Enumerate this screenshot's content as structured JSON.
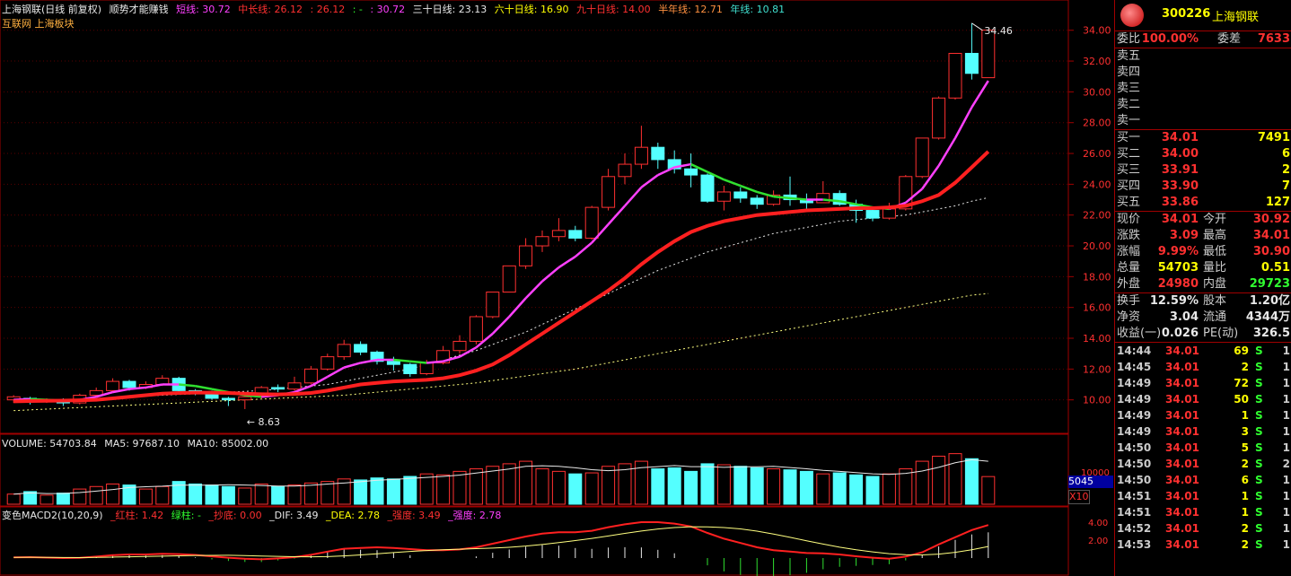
{
  "header": {
    "stock": "上海钢联(日线 前复权)",
    "title": "顺势才能赚钱",
    "ma_short": "短线: 30.72",
    "ma_mid": "中长线: 26.12",
    "ma_mid2": ": 26.12",
    "ma_dash": ": -",
    "ma_x": ": 30.72",
    "ma30": "三十日线: 23.13",
    "ma60": "六十日线: 16.90",
    "ma90": "九十日线: 14.00",
    "ma120": "半年线: 12.71",
    "ma250": "年线: 10.81",
    "sector": "互联网 上海板块"
  },
  "price_axis": [
    "34.00",
    "32.00",
    "30.00",
    "28.00",
    "26.00",
    "24.00",
    "22.00",
    "20.00",
    "18.00",
    "16.00",
    "14.00",
    "12.00",
    "10.00"
  ],
  "annotations": {
    "high": "34.46",
    "low": "8.63"
  },
  "volume": {
    "header_vol": "VOLUME: 54703.84",
    "header_ma5": "MA5: 97687.10",
    "header_ma10": "MA10: 85002.00",
    "axis_top": "10000",
    "box_value": "5045",
    "box_unit": "X10"
  },
  "macd": {
    "name": "变色MACD2(10,20,9)",
    "red_bar": "_红柱: 1.42",
    "green_bar": "绿柱: -",
    "bottom": "_抄底: 0.00",
    "dif": "_DIF: 3.49",
    "dea": "_DEA: 2.78",
    "strong1": "_强度: 3.49",
    "strong2": "_强度: 2.78",
    "axis": [
      "4.00",
      "2.00"
    ]
  },
  "quote": {
    "code": "300226",
    "name": "上海钢联",
    "weibi_label": "委比",
    "weibi": "100.00%",
    "weicha_label": "委差",
    "weicha": "7633",
    "sell": [
      {
        "label": "卖五",
        "price": "",
        "vol": ""
      },
      {
        "label": "卖四",
        "price": "",
        "vol": ""
      },
      {
        "label": "卖三",
        "price": "",
        "vol": ""
      },
      {
        "label": "卖二",
        "price": "",
        "vol": ""
      },
      {
        "label": "卖一",
        "price": "",
        "vol": ""
      }
    ],
    "buy": [
      {
        "label": "买一",
        "price": "34.01",
        "vol": "7491"
      },
      {
        "label": "买二",
        "price": "34.00",
        "vol": "6"
      },
      {
        "label": "买三",
        "price": "33.91",
        "vol": "2"
      },
      {
        "label": "买四",
        "price": "33.90",
        "vol": "7"
      },
      {
        "label": "买五",
        "price": "33.86",
        "vol": "127"
      }
    ],
    "stats": [
      {
        "l1": "现价",
        "v1": "34.01",
        "c1": "red",
        "l2": "今开",
        "v2": "30.92",
        "c2": "red"
      },
      {
        "l1": "涨跌",
        "v1": "3.09",
        "c1": "red",
        "l2": "最高",
        "v2": "34.01",
        "c2": "red"
      },
      {
        "l1": "涨幅",
        "v1": "9.99%",
        "c1": "red",
        "l2": "最低",
        "v2": "30.90",
        "c2": "red"
      },
      {
        "l1": "总量",
        "v1": "54703",
        "c1": "yel",
        "l2": "量比",
        "v2": "0.51",
        "c2": "yel"
      },
      {
        "l1": "外盘",
        "v1": "24980",
        "c1": "red",
        "l2": "内盘",
        "v2": "29723",
        "c2": "grn"
      }
    ],
    "stats2": [
      {
        "l1": "换手",
        "v1": "12.59%",
        "l2": "股本",
        "v2": "1.20亿"
      },
      {
        "l1": "净资",
        "v1": "3.04",
        "l2": "流通",
        "v2": "4344万"
      },
      {
        "l1": "收益(一)",
        "v1": "0.026",
        "l2": "PE(动)",
        "v2": "326.5"
      }
    ],
    "ticks": [
      {
        "t": "14:44",
        "p": "34.01",
        "v": "69",
        "bs": "S",
        "n": "1"
      },
      {
        "t": "14:45",
        "p": "34.01",
        "v": "2",
        "bs": "S",
        "n": "1"
      },
      {
        "t": "14:49",
        "p": "34.01",
        "v": "72",
        "bs": "S",
        "n": "1"
      },
      {
        "t": "14:49",
        "p": "34.01",
        "v": "50",
        "bs": "S",
        "n": "1"
      },
      {
        "t": "14:49",
        "p": "34.01",
        "v": "1",
        "bs": "S",
        "n": "1"
      },
      {
        "t": "14:49",
        "p": "34.01",
        "v": "3",
        "bs": "S",
        "n": "1"
      },
      {
        "t": "14:50",
        "p": "34.01",
        "v": "5",
        "bs": "S",
        "n": "1"
      },
      {
        "t": "14:50",
        "p": "34.01",
        "v": "2",
        "bs": "S",
        "n": "2"
      },
      {
        "t": "14:50",
        "p": "34.01",
        "v": "6",
        "bs": "S",
        "n": "1"
      },
      {
        "t": "14:51",
        "p": "34.01",
        "v": "1",
        "bs": "S",
        "n": "1"
      },
      {
        "t": "14:51",
        "p": "34.01",
        "v": "1",
        "bs": "S",
        "n": "1"
      },
      {
        "t": "14:52",
        "p": "34.01",
        "v": "2",
        "bs": "S",
        "n": "1"
      },
      {
        "t": "14:53",
        "p": "34.01",
        "v": "2",
        "bs": "S",
        "n": "1"
      }
    ]
  },
  "chart_data": {
    "type": "candlestick",
    "ylim": [
      8.0,
      34.8
    ],
    "candles": [
      [
        10.0,
        10.2,
        9.8,
        10.3
      ],
      [
        10.1,
        9.9,
        9.7,
        10.2
      ],
      [
        9.9,
        10.0,
        9.8,
        10.1
      ],
      [
        10.0,
        9.8,
        9.6,
        10.1
      ],
      [
        9.8,
        10.3,
        9.7,
        10.4
      ],
      [
        10.3,
        10.6,
        10.2,
        10.8
      ],
      [
        10.6,
        11.2,
        10.5,
        11.4
      ],
      [
        11.2,
        10.8,
        10.6,
        11.3
      ],
      [
        10.8,
        11.0,
        10.7,
        11.2
      ],
      [
        11.0,
        11.4,
        10.9,
        11.6
      ],
      [
        11.4,
        10.6,
        10.5,
        11.5
      ],
      [
        10.6,
        10.5,
        10.3,
        10.7
      ],
      [
        10.5,
        10.1,
        10.0,
        10.6
      ],
      [
        10.1,
        10.0,
        9.6,
        10.2
      ],
      [
        10.0,
        10.2,
        9.4,
        10.3
      ],
      [
        10.2,
        10.8,
        10.1,
        10.9
      ],
      [
        10.8,
        10.7,
        10.5,
        11.0
      ],
      [
        10.7,
        11.1,
        10.6,
        11.5
      ],
      [
        11.1,
        12.0,
        11.0,
        12.2
      ],
      [
        12.0,
        12.8,
        11.9,
        13.0
      ],
      [
        12.8,
        13.6,
        12.6,
        13.9
      ],
      [
        13.6,
        13.1,
        12.9,
        13.8
      ],
      [
        13.1,
        12.5,
        12.3,
        13.2
      ],
      [
        12.5,
        12.3,
        11.9,
        12.8
      ],
      [
        12.3,
        11.7,
        11.5,
        12.4
      ],
      [
        11.7,
        12.4,
        11.6,
        12.6
      ],
      [
        12.4,
        13.2,
        12.3,
        13.5
      ],
      [
        13.2,
        13.8,
        13.0,
        14.2
      ],
      [
        13.8,
        15.4,
        13.6,
        15.5
      ],
      [
        15.4,
        17.0,
        15.3,
        17.0
      ],
      [
        17.0,
        18.7,
        17.0,
        18.7
      ],
      [
        18.7,
        20.0,
        18.5,
        20.5
      ],
      [
        20.0,
        20.6,
        19.6,
        21.0
      ],
      [
        20.6,
        21.0,
        20.3,
        21.8
      ],
      [
        21.0,
        20.5,
        20.3,
        21.3
      ],
      [
        20.5,
        22.5,
        20.4,
        22.6
      ],
      [
        22.5,
        24.5,
        22.3,
        25.0
      ],
      [
        24.5,
        25.3,
        24.0,
        26.0
      ],
      [
        25.3,
        26.4,
        25.0,
        27.8
      ],
      [
        26.4,
        25.6,
        25.0,
        26.7
      ],
      [
        25.6,
        25.0,
        24.7,
        26.2
      ],
      [
        25.0,
        24.6,
        23.8,
        26.0
      ],
      [
        24.6,
        22.9,
        22.8,
        24.7
      ],
      [
        22.9,
        23.5,
        22.3,
        23.9
      ],
      [
        23.5,
        23.1,
        22.8,
        23.8
      ],
      [
        23.1,
        22.7,
        22.4,
        23.3
      ],
      [
        22.7,
        23.3,
        22.6,
        23.6
      ],
      [
        23.3,
        23.0,
        22.6,
        24.5
      ],
      [
        23.0,
        22.8,
        22.3,
        23.4
      ],
      [
        22.8,
        23.4,
        22.8,
        24.2
      ],
      [
        23.4,
        22.7,
        22.6,
        23.6
      ],
      [
        22.7,
        22.3,
        21.5,
        23.0
      ],
      [
        22.3,
        21.8,
        21.6,
        22.5
      ],
      [
        21.8,
        22.4,
        21.7,
        22.8
      ],
      [
        22.4,
        24.5,
        22.3,
        24.6
      ],
      [
        24.5,
        27.0,
        24.4,
        27.0
      ],
      [
        27.0,
        29.6,
        26.9,
        29.7
      ],
      [
        29.6,
        32.5,
        29.5,
        32.5
      ],
      [
        32.5,
        31.2,
        30.8,
        34.46
      ],
      [
        30.92,
        34.01,
        30.9,
        34.01
      ]
    ],
    "ma_short": [
      10.0,
      10.05,
      10.0,
      9.95,
      10.0,
      10.2,
      10.5,
      10.7,
      10.8,
      11.0,
      11.0,
      10.9,
      10.7,
      10.5,
      10.3,
      10.2,
      10.3,
      10.5,
      10.9,
      11.5,
      12.1,
      12.4,
      12.6,
      12.6,
      12.5,
      12.4,
      12.5,
      12.8,
      13.4,
      14.3,
      15.4,
      16.6,
      17.7,
      18.6,
      19.3,
      20.2,
      21.4,
      22.6,
      23.8,
      24.6,
      25.1,
      25.3,
      24.8,
      24.3,
      23.9,
      23.5,
      23.2,
      23.1,
      23.0,
      23.0,
      22.9,
      22.7,
      22.5,
      22.4,
      22.8,
      23.7,
      25.2,
      27.0,
      29.0,
      30.72
    ],
    "ma_mid": [
      9.9,
      9.92,
      9.94,
      9.95,
      9.97,
      10.0,
      10.1,
      10.2,
      10.3,
      10.4,
      10.45,
      10.47,
      10.47,
      10.45,
      10.4,
      10.37,
      10.35,
      10.38,
      10.45,
      10.6,
      10.8,
      11.0,
      11.1,
      11.2,
      11.25,
      11.3,
      11.4,
      11.6,
      11.9,
      12.3,
      12.9,
      13.6,
      14.3,
      15.0,
      15.7,
      16.4,
      17.1,
      17.9,
      18.8,
      19.6,
      20.3,
      20.9,
      21.3,
      21.6,
      21.8,
      22.0,
      22.1,
      22.2,
      22.3,
      22.35,
      22.4,
      22.45,
      22.45,
      22.5,
      22.6,
      22.9,
      23.3,
      24.1,
      25.1,
      26.12
    ],
    "volume": [
      20,
      25,
      18,
      22,
      30,
      35,
      40,
      38,
      30,
      35,
      45,
      40,
      38,
      35,
      32,
      40,
      35,
      38,
      42,
      45,
      50,
      48,
      52,
      50,
      55,
      60,
      58,
      65,
      70,
      75,
      80,
      85,
      70,
      65,
      60,
      62,
      75,
      80,
      85,
      70,
      72,
      65,
      80,
      78,
      75,
      72,
      70,
      68,
      65,
      60,
      62,
      58,
      55,
      60,
      70,
      85,
      95,
      100,
      90,
      54.7
    ],
    "ma30": [
      10.0,
      10.0,
      10.0,
      10.0,
      10.0,
      10.05,
      10.1,
      10.2,
      10.25,
      10.3,
      10.35,
      10.4,
      10.45,
      10.5,
      10.55,
      10.6,
      10.7,
      10.8,
      10.9,
      11.0,
      11.2,
      11.4,
      11.6,
      11.8,
      12.0,
      12.3,
      12.6,
      12.9,
      13.2,
      13.6,
      14.0,
      14.4,
      14.9,
      15.4,
      15.9,
      16.4,
      16.9,
      17.4,
      17.9,
      18.4,
      18.8,
      19.2,
      19.6,
      19.9,
      20.2,
      20.5,
      20.8,
      21.0,
      21.2,
      21.4,
      21.6,
      21.7,
      21.8,
      21.9,
      22.0,
      22.2,
      22.4,
      22.6,
      22.9,
      23.13
    ],
    "ma60": [
      9.3,
      9.35,
      9.4,
      9.45,
      9.5,
      9.55,
      9.6,
      9.65,
      9.7,
      9.75,
      9.8,
      9.85,
      9.9,
      9.95,
      10.0,
      10.05,
      10.1,
      10.15,
      10.2,
      10.25,
      10.3,
      10.4,
      10.5,
      10.6,
      10.7,
      10.8,
      10.9,
      11.0,
      11.1,
      11.25,
      11.4,
      11.55,
      11.7,
      11.85,
      12.0,
      12.2,
      12.4,
      12.6,
      12.8,
      13.0,
      13.2,
      13.4,
      13.6,
      13.8,
      14.0,
      14.2,
      14.4,
      14.6,
      14.8,
      15.0,
      15.2,
      15.4,
      15.6,
      15.8,
      16.0,
      16.2,
      16.4,
      16.6,
      16.8,
      16.9
    ]
  }
}
